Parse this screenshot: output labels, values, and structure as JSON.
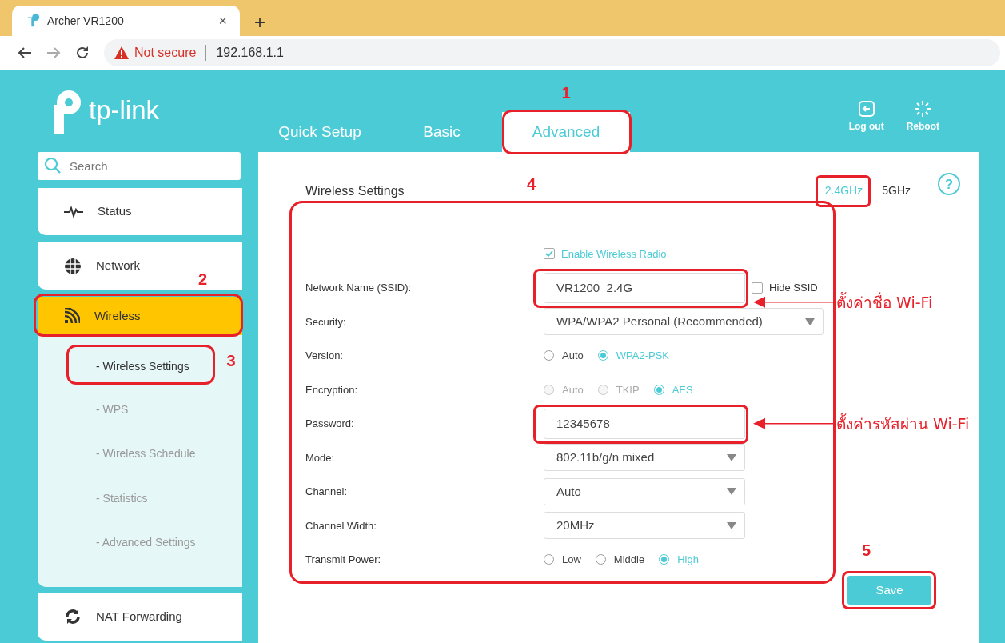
{
  "browser": {
    "tab_title": "Archer VR1200",
    "tab_close": "×",
    "new_tab": "+",
    "security_warning": "Not secure",
    "url": "192.168.1.1"
  },
  "header": {
    "logo": "tp-link",
    "nav_tabs": [
      {
        "label": "Quick Setup",
        "selected": false,
        "highlighted": false
      },
      {
        "label": "Basic",
        "selected": false,
        "highlighted": false
      },
      {
        "label": "Advanced",
        "selected": true,
        "highlighted": true,
        "step": "1"
      }
    ],
    "actions": [
      {
        "kind": "logout",
        "label": "Log out"
      },
      {
        "kind": "reboot",
        "label": "Reboot"
      }
    ]
  },
  "sidebar": {
    "search": {
      "placeholder": "Search"
    },
    "items": [
      {
        "kind": "status",
        "label": "Status",
        "selected": false,
        "highlighted": false
      },
      {
        "kind": "network",
        "label": "Network",
        "selected": false,
        "highlighted": false
      },
      {
        "kind": "wireless",
        "label": "Wireless",
        "selected": true,
        "highlighted": true,
        "step": "2",
        "children": [
          {
            "label": "- Wireless Settings",
            "selected": true,
            "highlighted": true,
            "step": "3"
          },
          {
            "label": "- WPS",
            "selected": false,
            "highlighted": false
          },
          {
            "label": "- Wireless Schedule",
            "selected": false,
            "highlighted": false
          },
          {
            "label": "- Statistics",
            "selected": false,
            "highlighted": false
          },
          {
            "label": "- Advanced Settings",
            "selected": false,
            "highlighted": false
          }
        ]
      },
      {
        "kind": "nat",
        "label": "NAT Forwarding",
        "selected": false,
        "highlighted": false
      }
    ]
  },
  "panel": {
    "title": "Wireless Settings",
    "help": "?",
    "bands": [
      {
        "label": "2.4GHz",
        "selected": true,
        "highlighted": true
      },
      {
        "label": "5GHz",
        "selected": false,
        "highlighted": false
      }
    ],
    "form": {
      "highlighted": true,
      "step": "4",
      "rows": [
        {
          "kind": "checkbox",
          "label": "Enable Wireless Radio",
          "checked": true
        },
        {
          "kind": "text",
          "label": "Network Name (SSID):",
          "value": "VR1200_2.4G",
          "highlighted": true,
          "callout": "ตั้งค่าชื่อ Wi-Fi",
          "extra": {
            "label": "Hide SSID",
            "checked": false
          }
        },
        {
          "kind": "select",
          "label": "Security:",
          "value": "WPA/WPA2 Personal (Recommended)",
          "wide": true
        },
        {
          "kind": "radio",
          "label": "Version:",
          "options": [
            {
              "label": "Auto",
              "selected": false,
              "disabled": false
            },
            {
              "label": "WPA2-PSK",
              "selected": true,
              "disabled": false
            }
          ]
        },
        {
          "kind": "radio",
          "label": "Encryption:",
          "options": [
            {
              "label": "Auto",
              "selected": false,
              "disabled": true
            },
            {
              "label": "TKIP",
              "selected": false,
              "disabled": true
            },
            {
              "label": "AES",
              "selected": true,
              "disabled": false
            }
          ]
        },
        {
          "kind": "text",
          "label": "Password:",
          "value": "12345678",
          "highlighted": true,
          "callout": "ตั้งค่ารหัสผ่าน Wi-Fi"
        },
        {
          "kind": "select",
          "label": "Mode:",
          "value": "802.11b/g/n mixed",
          "wide": false
        },
        {
          "kind": "select",
          "label": "Channel:",
          "value": "Auto",
          "wide": false
        },
        {
          "kind": "select",
          "label": "Channel Width:",
          "value": "20MHz",
          "wide": false
        },
        {
          "kind": "radio",
          "label": "Transmit Power:",
          "options": [
            {
              "label": "Low",
              "selected": false,
              "disabled": false
            },
            {
              "label": "Middle",
              "selected": false,
              "disabled": false
            },
            {
              "label": "High",
              "selected": true,
              "disabled": false
            }
          ]
        }
      ]
    },
    "save": {
      "label": "Save",
      "highlighted": true,
      "step": "5"
    }
  }
}
